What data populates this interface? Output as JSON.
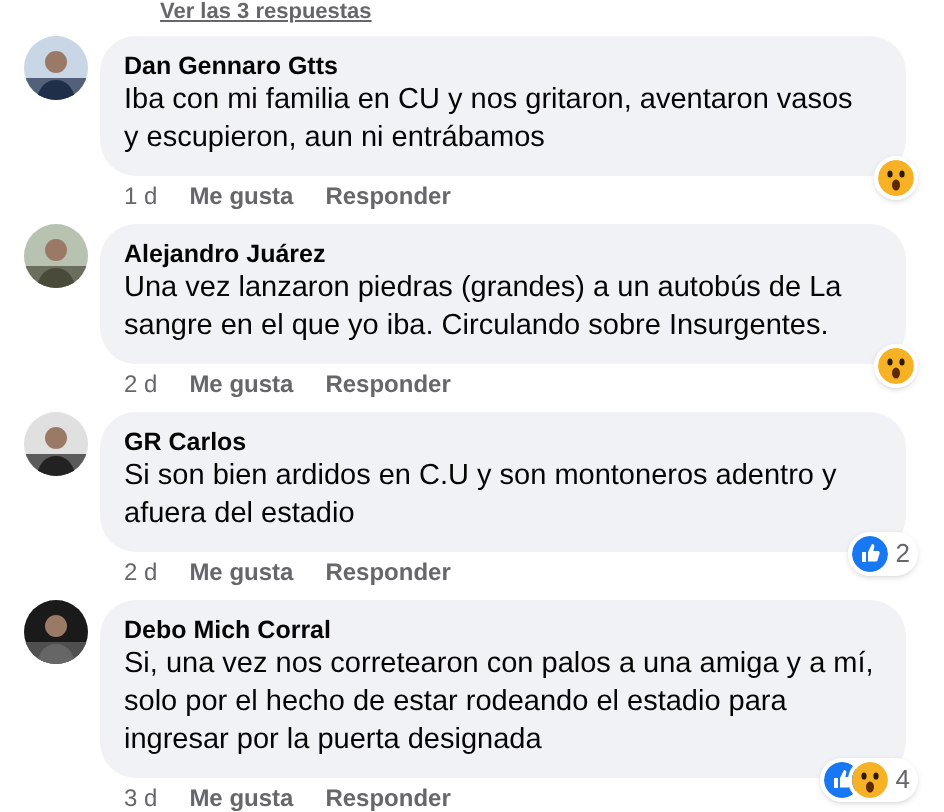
{
  "replies_link": {
    "label": "Ver las 3 respuestas"
  },
  "comments": [
    {
      "author": "Dan Gennaro Gtts",
      "text": [
        "Iba con mi familia en CU y nos gritaron, aventaron vasos",
        "y escupieron, aun ni entrábamos"
      ],
      "time": "1 d",
      "like": "Me gusta",
      "reply": "Responder",
      "reactions": [
        {
          "kind": "wow"
        }
      ]
    },
    {
      "author": "Alejandro Juárez",
      "text": [
        "Una vez lanzaron piedras (grandes) a un autobús de La",
        "sangre en el que yo iba. Circulando sobre Insurgentes."
      ],
      "time": "2 d",
      "like": "Me gusta",
      "reply": "Responder",
      "reactions": [
        {
          "kind": "wow"
        }
      ]
    },
    {
      "author": "GR Carlos",
      "text": [
        "Si son bien ardidos en C.U y son montoneros adentro y",
        "afuera del estadio"
      ],
      "time": "2 d",
      "like": "Me gusta",
      "reply": "Responder",
      "reactions": [
        {
          "kind": "like"
        }
      ],
      "count": "2"
    },
    {
      "author": "Debo Mich Corral",
      "text": [
        "Si, una vez nos corretearon con palos a una amiga y a mí,",
        "solo por el hecho de estar rodeando el estadio para",
        "ingresar por la puerta designada"
      ],
      "time": "3 d",
      "like": "Me gusta",
      "reply": "Responder",
      "reactions": [
        {
          "kind": "like"
        },
        {
          "kind": "wow"
        }
      ],
      "count": "4"
    }
  ]
}
